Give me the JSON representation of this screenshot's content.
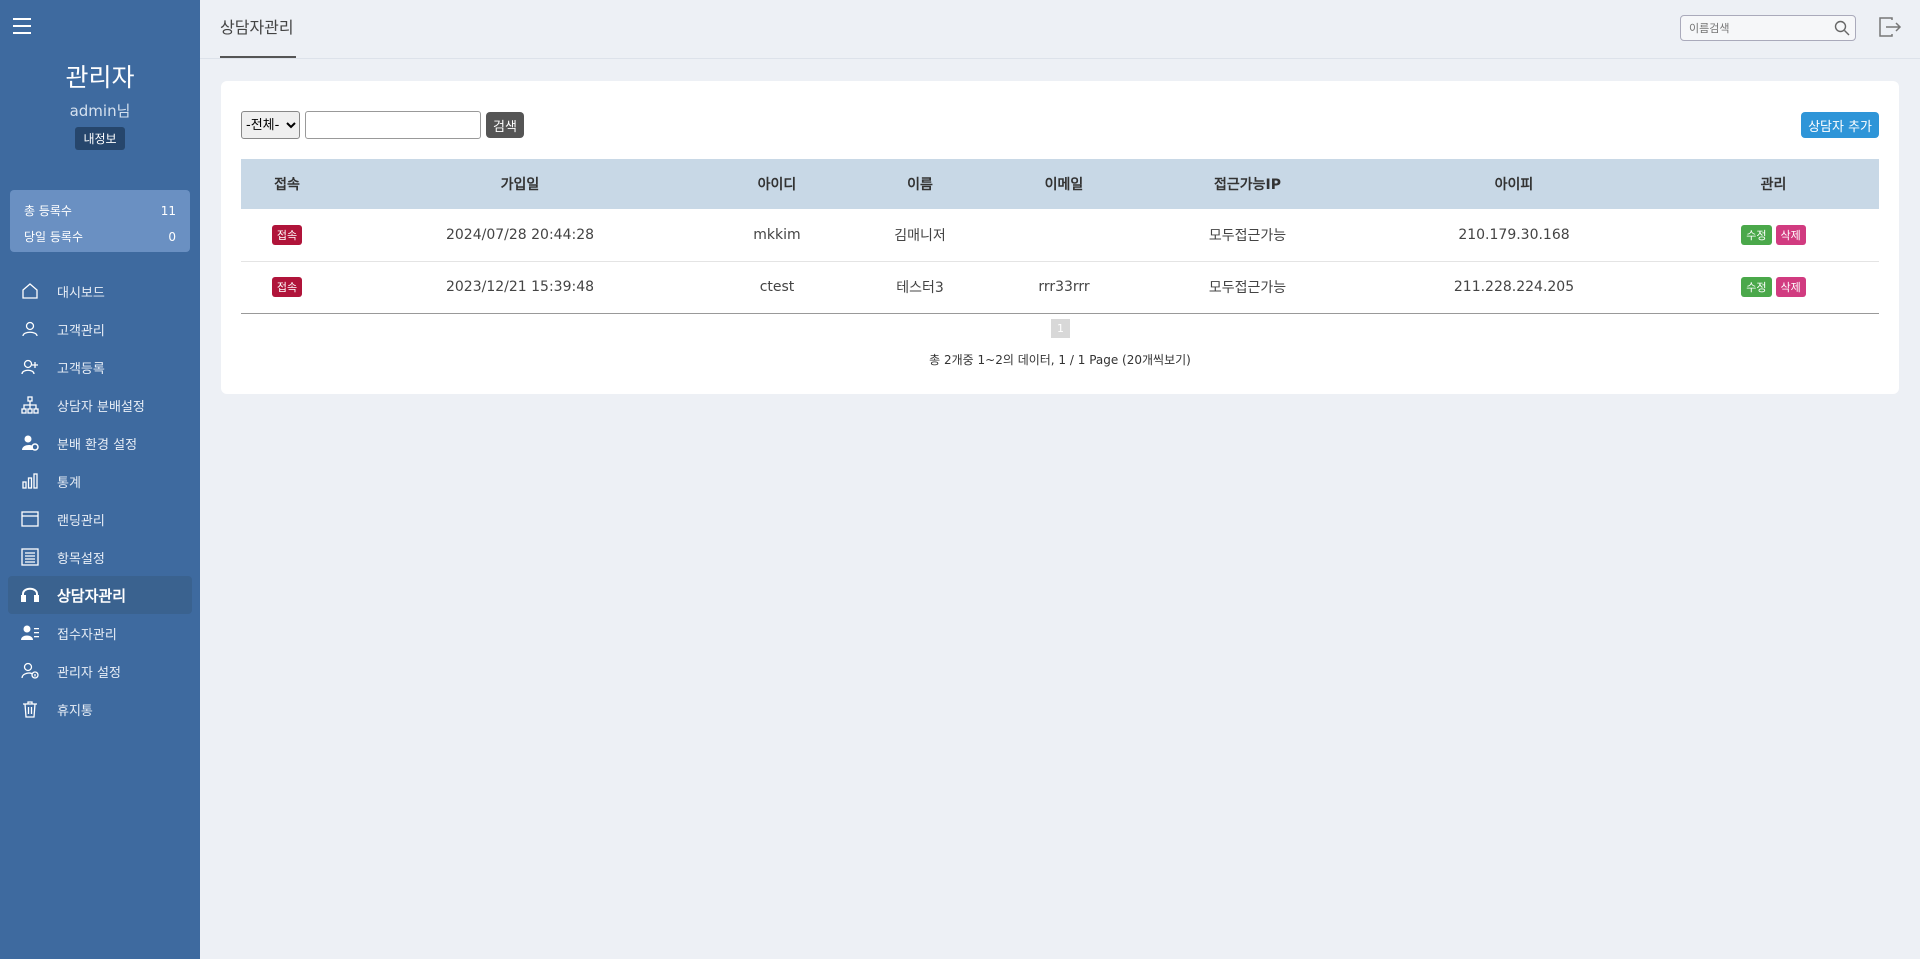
{
  "sidebar": {
    "role": "관리자",
    "user": "admin님",
    "my_info_label": "내정보",
    "stats": [
      {
        "label": "총 등록수",
        "value": "11"
      },
      {
        "label": "당일 등록수",
        "value": "0"
      }
    ],
    "menu": [
      {
        "label": "대시보드",
        "icon": "home-icon"
      },
      {
        "label": "고객관리",
        "icon": "user-icon"
      },
      {
        "label": "고객등록",
        "icon": "user-plus-icon"
      },
      {
        "label": "상담자 분배설정",
        "icon": "sitemap-icon"
      },
      {
        "label": "분배 환경 설정",
        "icon": "user-gear-icon"
      },
      {
        "label": "통계",
        "icon": "bar-chart-icon"
      },
      {
        "label": "랜딩관리",
        "icon": "window-icon"
      },
      {
        "label": "항목설정",
        "icon": "list-icon"
      },
      {
        "label": "상담자관리",
        "icon": "headset-icon",
        "active": true
      },
      {
        "label": "접수자관리",
        "icon": "user-list-icon"
      },
      {
        "label": "관리자 설정",
        "icon": "user-info-icon"
      },
      {
        "label": "휴지통",
        "icon": "trash-icon"
      }
    ]
  },
  "topbar": {
    "title": "상담자관리",
    "search_placeholder": "이름검색"
  },
  "filter": {
    "select_value": "-전체-",
    "search_label": "검색",
    "add_label": "상담자 추가"
  },
  "table": {
    "headers": [
      "접속",
      "가입일",
      "아이디",
      "이름",
      "이메일",
      "접근가능IP",
      "아이피",
      "관리"
    ],
    "rows": [
      {
        "status": "접속",
        "joined": "2024/07/28 20:44:28",
        "id": "mkkim",
        "name": "김매니저",
        "email": "",
        "allowed_ip": "모두접근가능",
        "ip": "210.179.30.168"
      },
      {
        "status": "접속",
        "joined": "2023/12/21 15:39:48",
        "id": "ctest",
        "name": "테스터3",
        "email": "rrr33rrr",
        "allowed_ip": "모두접근가능",
        "ip": "211.228.224.205"
      }
    ],
    "edit_label": "수정",
    "delete_label": "삭제"
  },
  "pagination": {
    "current": "1",
    "summary": "총 2개중 1~2의 데이터, 1 / 1 Page (20개씩보기)"
  },
  "colors": {
    "sidebar_bg": "#3e6a9f",
    "badge_connect": "#b0143a",
    "edit": "#4aa84a",
    "delete": "#d13b80",
    "add_button": "#2e95d8"
  }
}
